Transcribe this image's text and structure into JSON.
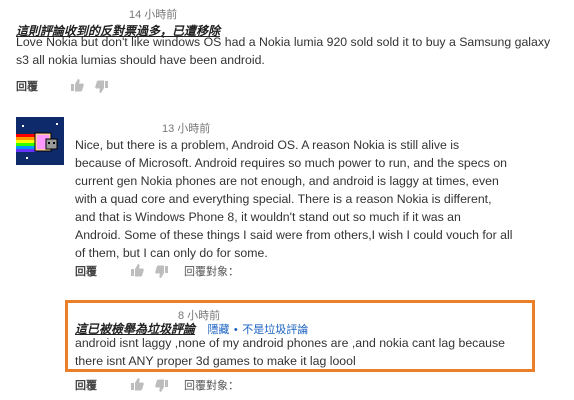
{
  "comment1": {
    "timestamp": "14 小時前",
    "notice": "這則評論收到的反對票過多，已遭移除",
    "body": "Love Nokia but don't like windows OS had a Nokia lumia 920 sold sold it to buy a Samsung galaxy s3 all nokia lumias should have been android.",
    "reply_label": "回覆"
  },
  "comment2": {
    "timestamp": "13 小時前",
    "author": "Nice, but there is a problem, Android OS. A reason Nokia is still alive is",
    "lines": [
      "Nice, but there is a problem, Android OS. A reason Nokia is still alive is",
      "because of Microsoft. Android requires so much power to run, and the specs on",
      "current gen Nokia phones are not enough, and android is laggy at times, even",
      "with a quad core and everything special. There is a reason Nokia is different,",
      "and that is Windows Phone 8, it wouldn't stand out so much if it was an",
      "Android. Some of these things I said were from others,I wish I could vouch for all",
      "of them, but I can only do for some."
    ],
    "reply_label": "回覆",
    "reply_to_label": "回覆對象："
  },
  "comment3": {
    "timestamp": "8 小時前",
    "notice": "這已被檢舉為垃圾評論",
    "hide_label": "隱藏",
    "separator": "•",
    "not_spam_label": "不是垃圾評論",
    "lines": [
      "android isnt laggy ,none of my android phones are ,and nokia cant lag because",
      "there isnt ANY proper 3d games to make it lag loool"
    ],
    "reply_label": "回覆",
    "reply_to_label": "回覆對象："
  },
  "colors": {
    "highlight_border": "#ec7f2b",
    "link": "#1b62c2"
  },
  "icons": [
    "thumb-up-icon",
    "thumb-down-icon",
    "nyan-cat-avatar"
  ]
}
